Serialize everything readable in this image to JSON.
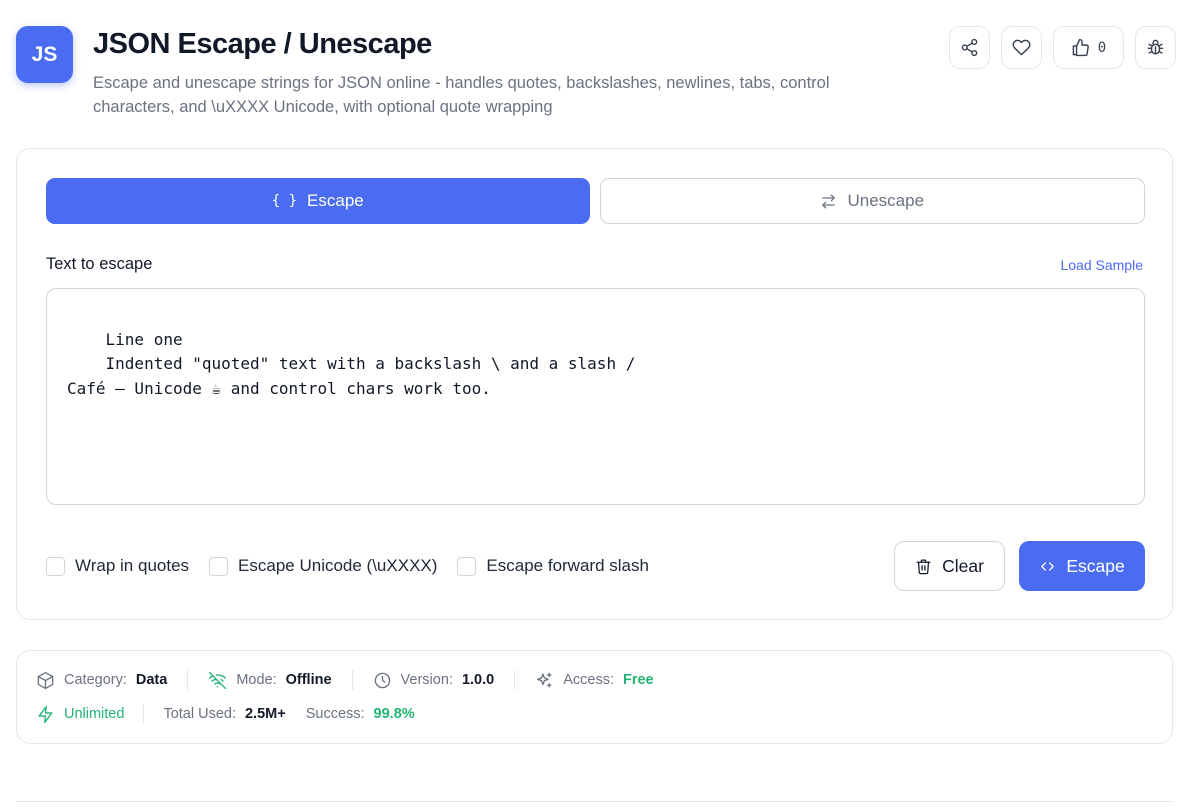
{
  "header": {
    "logo_text": "JS",
    "title": "JSON Escape / Unescape",
    "subtitle": "Escape and unescape strings for JSON online - handles quotes, backslashes, newlines, tabs, control characters, and \\uXXXX Unicode, with optional quote wrapping",
    "actions": {
      "like_count": "0"
    },
    "icons": [
      "share-icon",
      "heart-icon",
      "thumbs-up-icon",
      "bug-icon"
    ]
  },
  "tabs": [
    {
      "label": "Escape",
      "icon": "{ }",
      "active": true
    },
    {
      "label": "Unescape",
      "icon": "swap-arrows-icon",
      "active": false
    }
  ],
  "input": {
    "label": "Text to escape",
    "load_sample": "Load Sample",
    "value": "Line one\n    Indented \"quoted\" text with a backslash \\ and a slash /\nCafé — Unicode ☕ and control chars work too."
  },
  "options": [
    {
      "label": "Wrap in quotes",
      "checked": false
    },
    {
      "label": "Escape Unicode (\\uXXXX)",
      "checked": false
    },
    {
      "label": "Escape forward slash",
      "checked": false
    }
  ],
  "buttons": {
    "clear": "Clear",
    "escape": "Escape"
  },
  "meta": {
    "category_label": "Category:",
    "category_value": "Data",
    "mode_label": "Mode:",
    "mode_value": "Offline",
    "version_label": "Version:",
    "version_value": "1.0.0",
    "access_label": "Access:",
    "access_value": "Free",
    "unlimited": "Unlimited",
    "total_used_label": "Total Used:",
    "total_used_value": "2.5M+",
    "success_label": "Success:",
    "success_value": "99.8%"
  },
  "colors": {
    "accent": "#4a6cf0",
    "green": "#22b573",
    "border": "#e5e7eb",
    "muted": "#6b7280"
  }
}
